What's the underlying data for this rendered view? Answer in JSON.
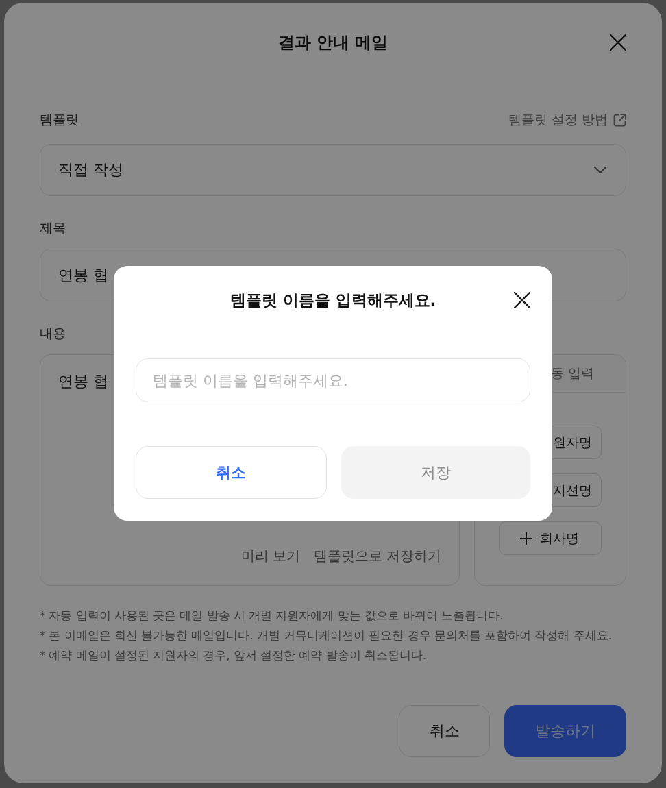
{
  "background_modal": {
    "title": "결과 안내 메일",
    "template": {
      "label": "템플릿",
      "help_link": "템플릿 설정 방법",
      "value": "직접 작성"
    },
    "subject": {
      "label": "제목",
      "value": "연봉 협"
    },
    "content": {
      "label": "내용",
      "value": "연봉 협",
      "links": [
        "미리 보기",
        "템플릿으로 저장하기"
      ]
    },
    "auto_input": {
      "header": "동 입력",
      "chips": [
        {
          "label": "원자명",
          "kind": "clipped"
        },
        {
          "label": "지션명",
          "kind": "clipped"
        },
        {
          "label": "회사명",
          "kind": "add"
        }
      ]
    },
    "notes": [
      "* 자동 입력이 사용된 곳은 메일 발송 시 개별 지원자에게 맞는 값으로 바뀌어 노출됩니다.",
      "* 본 이메일은 회신 불가능한 메일입니다. 개별 커뮤니케이션이 필요한 경우 문의처를 포함하여 작성해 주세요.",
      "* 예약 메일이 설정된 지원자의 경우, 앞서 설정한 예약 발송이 취소됩니다."
    ],
    "buttons": [
      {
        "label": "취소",
        "kind": "secondary"
      },
      {
        "label": "발송하기",
        "kind": "primary"
      }
    ]
  },
  "dialog": {
    "title": "템플릿 이름을 입력해주세요.",
    "input": {
      "placeholder": "템플릿 이름을 입력해주세요."
    },
    "buttons": [
      {
        "label": "취소",
        "kind": "cancel",
        "disabled": false
      },
      {
        "label": "저장",
        "kind": "save",
        "disabled": true
      }
    ]
  }
}
